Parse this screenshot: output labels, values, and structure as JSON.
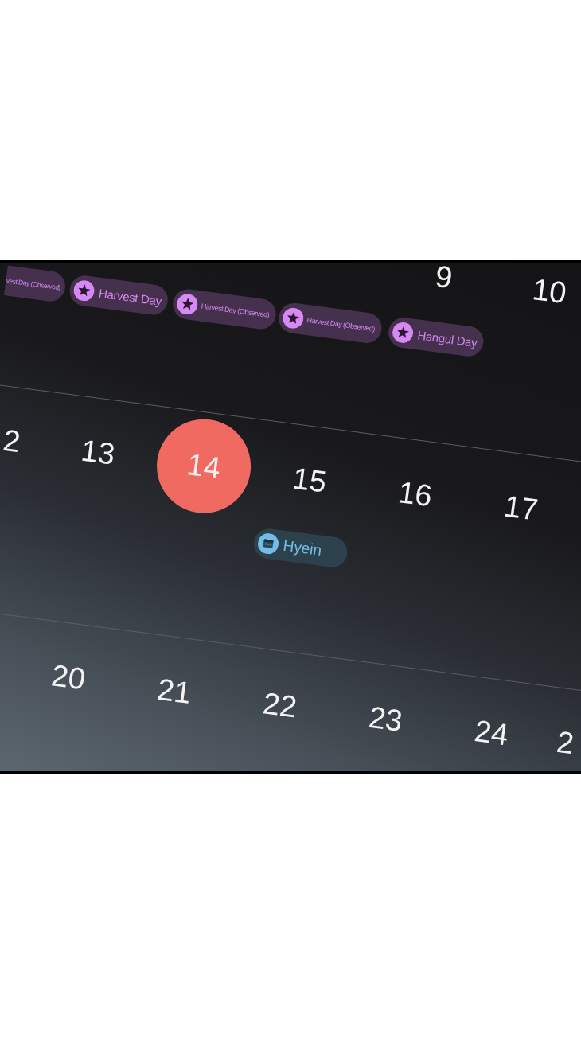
{
  "calendar": {
    "weeks": [
      {
        "cut_left": {
          "events": [
            {
              "kind": "truncated",
              "label": "vest Day (Observed)",
              "color": "#45304d"
            }
          ]
        },
        "days": [
          {
            "events": [
              {
                "kind": "holiday",
                "label": "Harvest Day",
                "color": "#45304d"
              }
            ]
          },
          {
            "events": [
              {
                "kind": "holiday",
                "label": "Harvest Day (Observed)",
                "color": "#45304d"
              }
            ]
          },
          {
            "events": [
              {
                "kind": "holiday",
                "label": "Harvest Day (Observed)",
                "color": "#45304d"
              }
            ]
          },
          {
            "date": "9",
            "today": false,
            "events": [
              {
                "kind": "holiday",
                "label": "Hangul Day",
                "color": "#45304d"
              }
            ]
          },
          {
            "date": "10",
            "today": false
          }
        ]
      },
      {
        "cut_left": {
          "date": "2",
          "today": false
        },
        "days": [
          {
            "date": "13",
            "today": false
          },
          {
            "date": "14",
            "today": true
          },
          {
            "date": "15",
            "today": false,
            "events": [
              {
                "kind": "calendar",
                "label": "Hyein",
                "color": "#2d414c"
              }
            ]
          },
          {
            "date": "16",
            "today": false
          },
          {
            "date": "17",
            "today": false
          }
        ]
      },
      {
        "days": [
          {
            "date": "20",
            "today": false
          },
          {
            "date": "21",
            "today": false
          },
          {
            "date": "22",
            "today": false
          },
          {
            "date": "23",
            "today": false
          },
          {
            "date": "24",
            "today": false
          }
        ],
        "cut_right": {
          "date": "2",
          "today": false
        }
      }
    ]
  }
}
